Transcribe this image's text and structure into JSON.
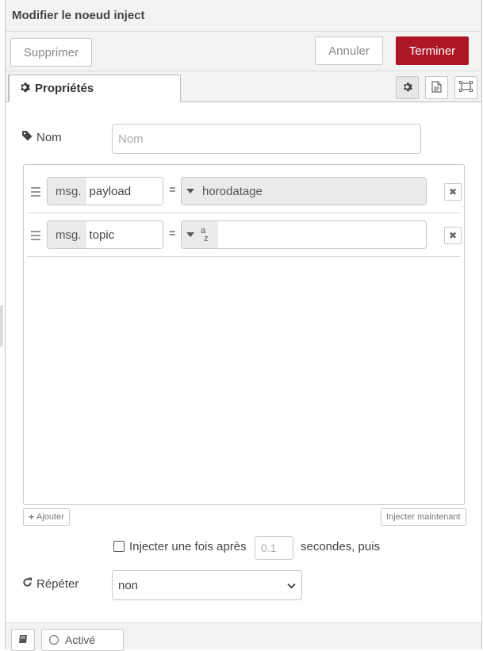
{
  "tray": {
    "title": "Modifier le noeud inject"
  },
  "toolbar": {
    "delete_label": "Supprimer",
    "cancel_label": "Annuler",
    "done_label": "Terminer",
    "accent": "#ad1625"
  },
  "tabs": {
    "properties_label": "Propriétés",
    "icons": [
      "gear-icon",
      "description-icon",
      "appearance-icon"
    ]
  },
  "form": {
    "name_label": "Nom",
    "name_placeholder": "Nom",
    "name_value": "",
    "props": [
      {
        "prefix": "msg.",
        "property": "payload",
        "equals": "=",
        "type_label": "horodatage"
      },
      {
        "prefix": "msg.",
        "property": "topic",
        "equals": "=",
        "type_label": "",
        "type_glyph_top": "a",
        "type_glyph_bottom": "z"
      }
    ],
    "add_label": "Ajouter",
    "inject_now_label": "Injecter maintenant",
    "inject_once_label": "Injecter une fois après",
    "inject_once_delay_placeholder": "0.1",
    "seconds_then_label": "secondes, puis",
    "repeat_label": "Répéter",
    "repeat_value": "non"
  },
  "footer": {
    "enabled_label": "Activé"
  }
}
